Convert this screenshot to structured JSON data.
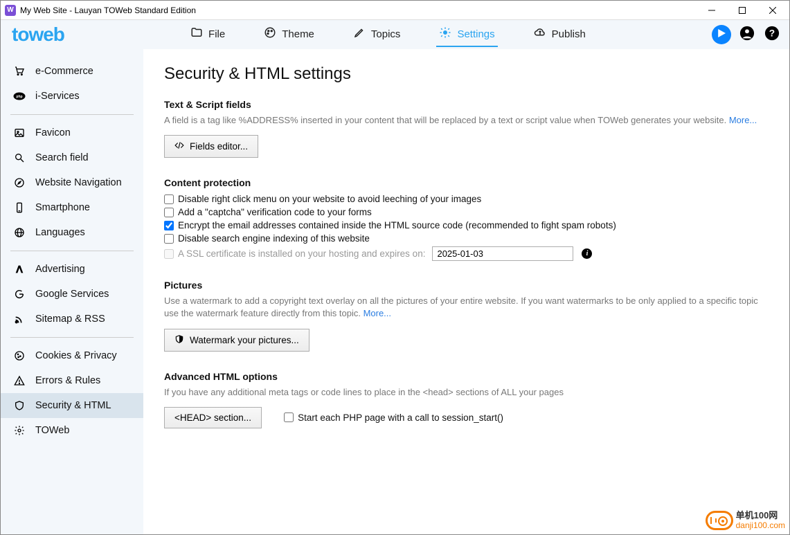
{
  "window": {
    "title": "My Web Site - Lauyan TOWeb Standard Edition",
    "app_icon_letter": "W"
  },
  "logo": "toweb",
  "nav": {
    "file": "File",
    "theme": "Theme",
    "topics": "Topics",
    "settings": "Settings",
    "publish": "Publish"
  },
  "sidebar": {
    "ecommerce": "e-Commerce",
    "iservices": "i-Services",
    "favicon": "Favicon",
    "search": "Search field",
    "navigation": "Website Navigation",
    "smartphone": "Smartphone",
    "languages": "Languages",
    "advertising": "Advertising",
    "google": "Google Services",
    "sitemap": "Sitemap & RSS",
    "cookies": "Cookies & Privacy",
    "errors": "Errors & Rules",
    "security": "Security & HTML",
    "toweb": "TOWeb"
  },
  "page": {
    "title": "Security & HTML settings",
    "text_script": {
      "title": "Text & Script fields",
      "desc": "A field is a tag like %ADDRESS% inserted in your content that will be replaced by a text or script value when TOWeb generates your website. ",
      "more": "More...",
      "button": "Fields editor..."
    },
    "protection": {
      "title": "Content protection",
      "disable_rightclick": "Disable right click menu on your website to avoid leeching of your images",
      "captcha": "Add a \"captcha\" verification code to your forms",
      "encrypt": "Encrypt the email addresses contained inside the HTML source code (recommended to fight spam robots)",
      "disable_indexing": "Disable search engine indexing of this website",
      "ssl": "A SSL certificate is installed on your hosting and expires on:",
      "ssl_date": "2025-01-03"
    },
    "pictures": {
      "title": "Pictures",
      "desc": "Use a watermark to add a copyright text overlay on all the pictures of your entire website. If you want watermarks to be only applied to a specific topic use the watermark feature directly from this topic. ",
      "more": "More...",
      "button": "Watermark your pictures..."
    },
    "advanced": {
      "title": "Advanced HTML options",
      "desc": "If you have any additional meta tags or code lines to place in the <head> sections of ALL your pages",
      "button": "<HEAD> section...",
      "php": "Start each PHP page with a call to session_start()"
    }
  },
  "watermark": {
    "line1": "单机100网",
    "line2": "danji100.com"
  }
}
